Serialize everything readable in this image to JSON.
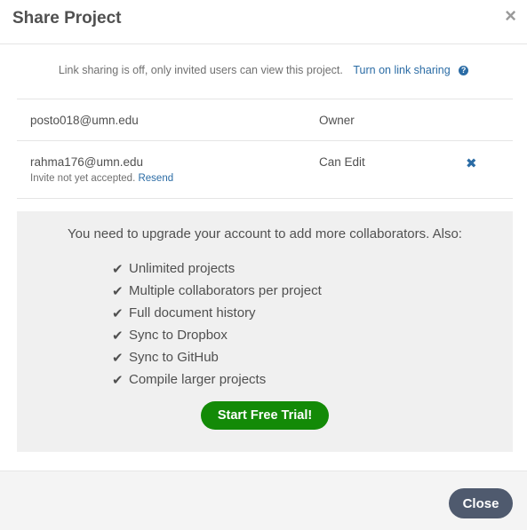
{
  "header": {
    "title": "Share Project",
    "close_glyph": "×"
  },
  "link_sharing": {
    "status": "Link sharing is off, only invited users can view this project.",
    "toggle_label": "Turn on link sharing",
    "help_glyph": "?"
  },
  "members": [
    {
      "email": "posto018@umn.edu",
      "role": "Owner"
    },
    {
      "email": "rahma176@umn.edu",
      "role": "Can Edit",
      "pending_text": "Invite not yet accepted.",
      "resend_label": "Resend",
      "remove_glyph": "✖"
    }
  ],
  "upgrade": {
    "message": "You need to upgrade your account to add more collaborators. Also:",
    "features": [
      "Unlimited projects",
      "Multiple collaborators per project",
      "Full document history",
      "Sync to Dropbox",
      "Sync to GitHub",
      "Compile larger projects"
    ],
    "check_glyph": "✔",
    "trial_button": "Start Free Trial!"
  },
  "footer": {
    "close_label": "Close"
  },
  "colors": {
    "accent": "#2b6ca5",
    "trial_green": "#138a07",
    "close_button": "#4f5a6e",
    "panel_bg": "#f0f0f0"
  }
}
